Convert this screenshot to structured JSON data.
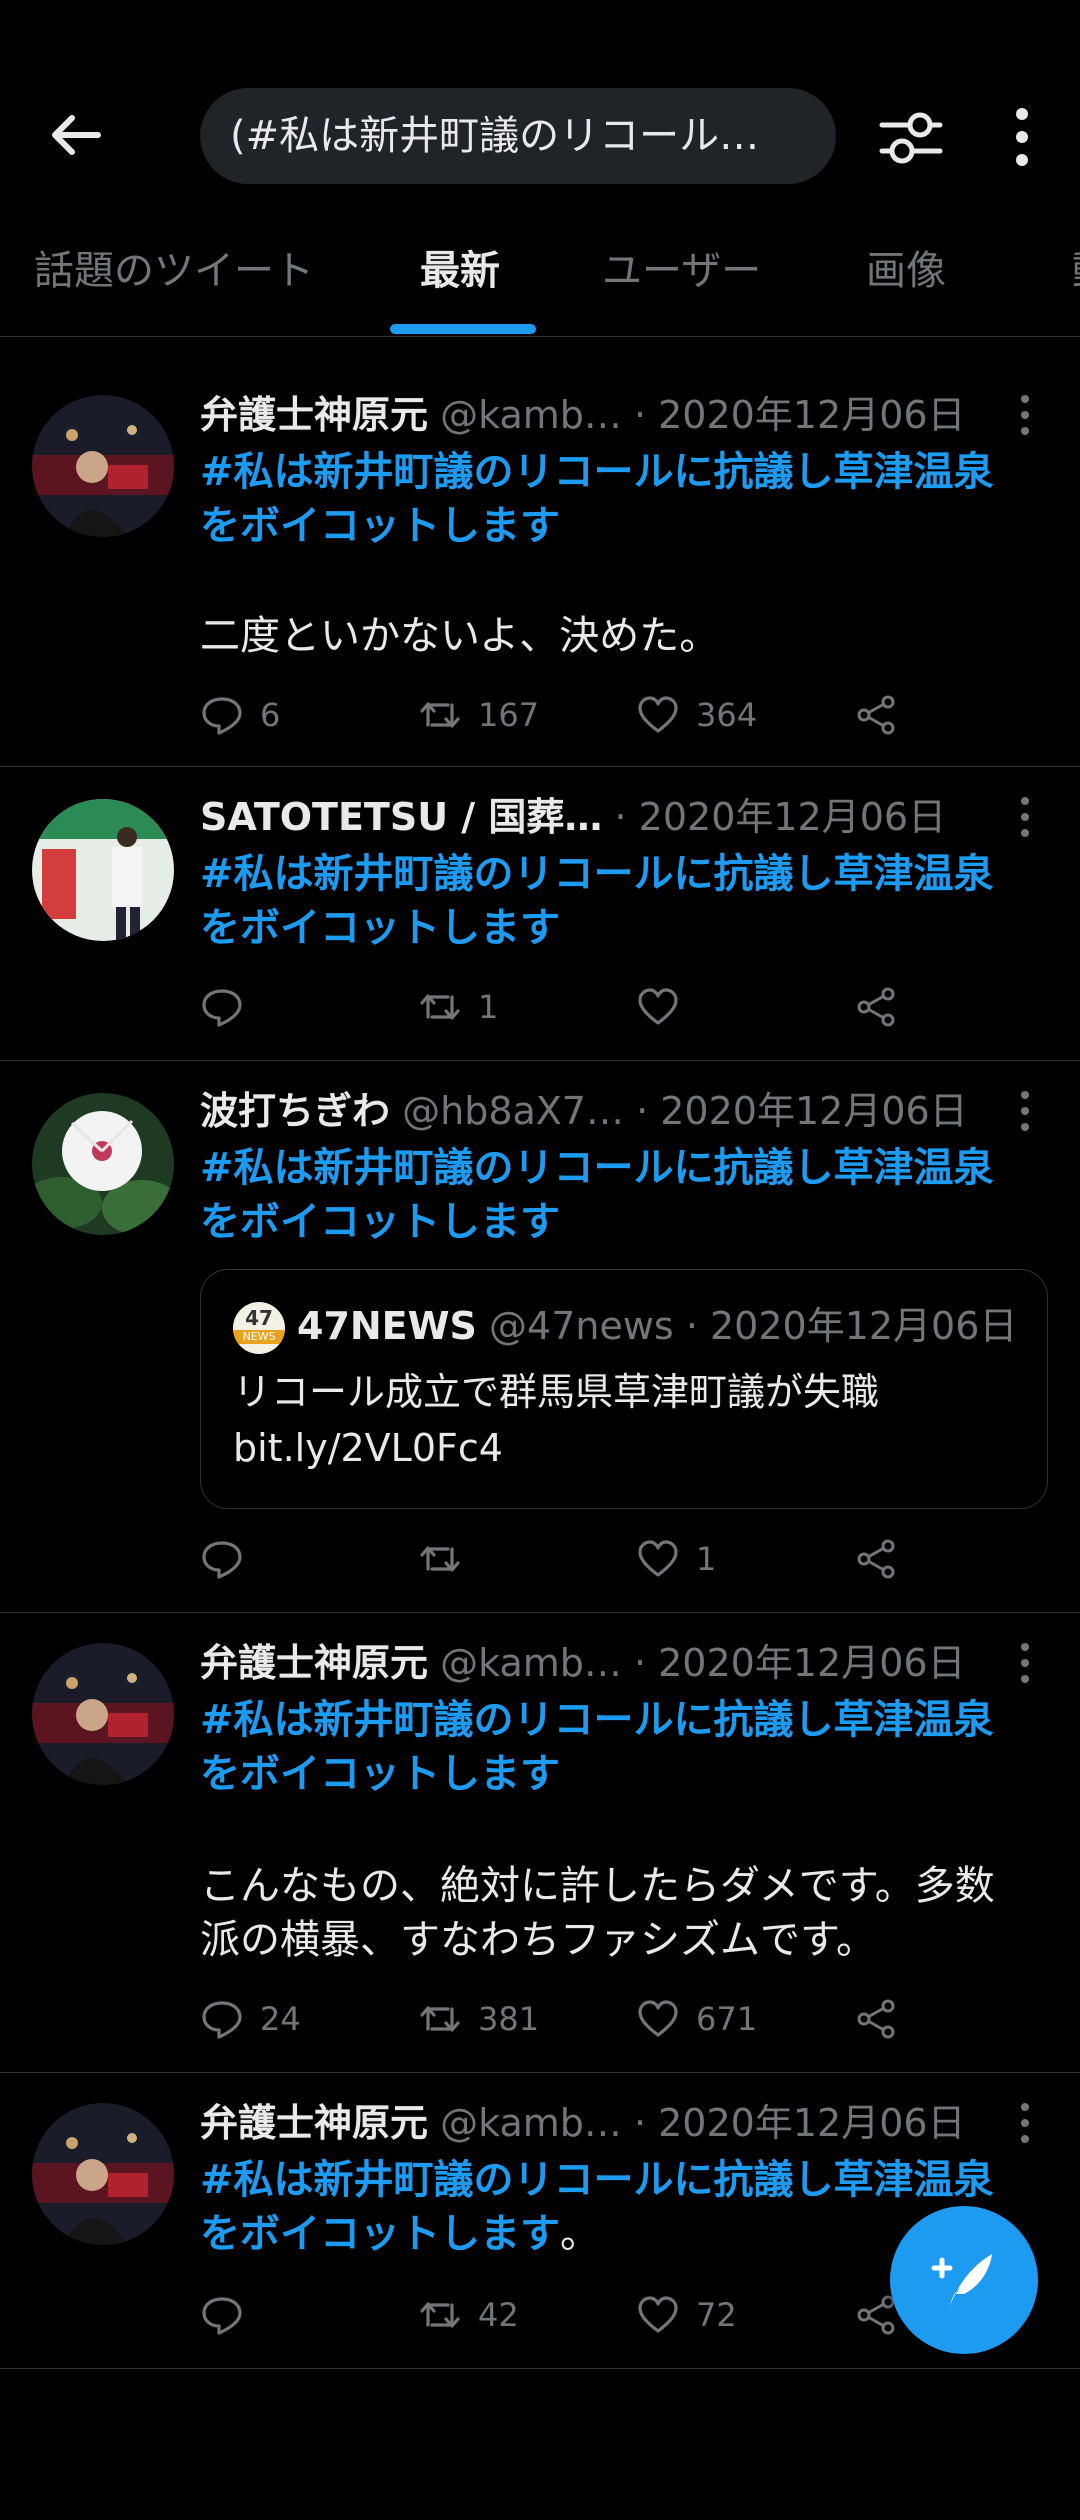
{
  "search": {
    "query": "(#私は新井町議のリコール…"
  },
  "tabs": [
    "話題のツイート",
    "最新",
    "ユーザー",
    "画像",
    "動"
  ],
  "hashtag": "#私は新井町議のリコールに抗議し草津温泉をボイコットします",
  "tweets": [
    {
      "name": "弁護士神原元",
      "handle": "@kamb…",
      "date": "· 2020年12月06日",
      "hashtag_line1": "#私は新井町議のリコールに抗議し草津温泉",
      "hashtag_line2": "をボイコットします",
      "text": "二度といかないよ、決めた。",
      "replies": "6",
      "retweets": "167",
      "likes": "364"
    },
    {
      "name": "SATOTETSU / 国葬…",
      "handle": "",
      "date": "· 2020年12月06日",
      "hashtag_line1": "#私は新井町議のリコールに抗議し草津温泉",
      "hashtag_line2": "をボイコットします",
      "replies": "",
      "retweets": "1",
      "likes": ""
    },
    {
      "name": "波打ちぎわ",
      "handle": "@hb8aX7…",
      "date": "· 2020年12月06日",
      "hashtag_line1": "#私は新井町議のリコールに抗議し草津温泉",
      "hashtag_line2": "をボイコットします",
      "quote": {
        "name": "47NEWS",
        "handle": "@47news",
        "date": "· 2020年12月06日",
        "avatar_text": "47",
        "avatar_sub": "NEWS",
        "line1": "リコール成立で群馬県草津町議が失職",
        "line2": "bit.ly/2VL0Fc4"
      },
      "replies": "",
      "retweets": "",
      "likes": "1"
    },
    {
      "name": "弁護士神原元",
      "handle": "@kamb…",
      "date": "· 2020年12月06日",
      "hashtag_line1": "#私は新井町議のリコールに抗議し草津温泉",
      "hashtag_line2": "をボイコットします",
      "text_line1": "こんなもの、絶対に許したらダメです。多数",
      "text_line2": "派の横暴、すなわちファシズムです。",
      "replies": "24",
      "retweets": "381",
      "likes": "671"
    },
    {
      "name": "弁護士神原元",
      "handle": "@kamb…",
      "date": "· 2020年12月06日",
      "hashtag_line1": "#私は新井町議のリコールに抗議し草津温泉",
      "hashtag_line2": "をボイコットします",
      "suffix": "。",
      "replies": "",
      "retweets": "42",
      "likes": "72"
    }
  ],
  "colors": {
    "accent": "#1d9bf0",
    "background": "#000000",
    "muted": "#71767b",
    "divider": "#2f3336"
  }
}
